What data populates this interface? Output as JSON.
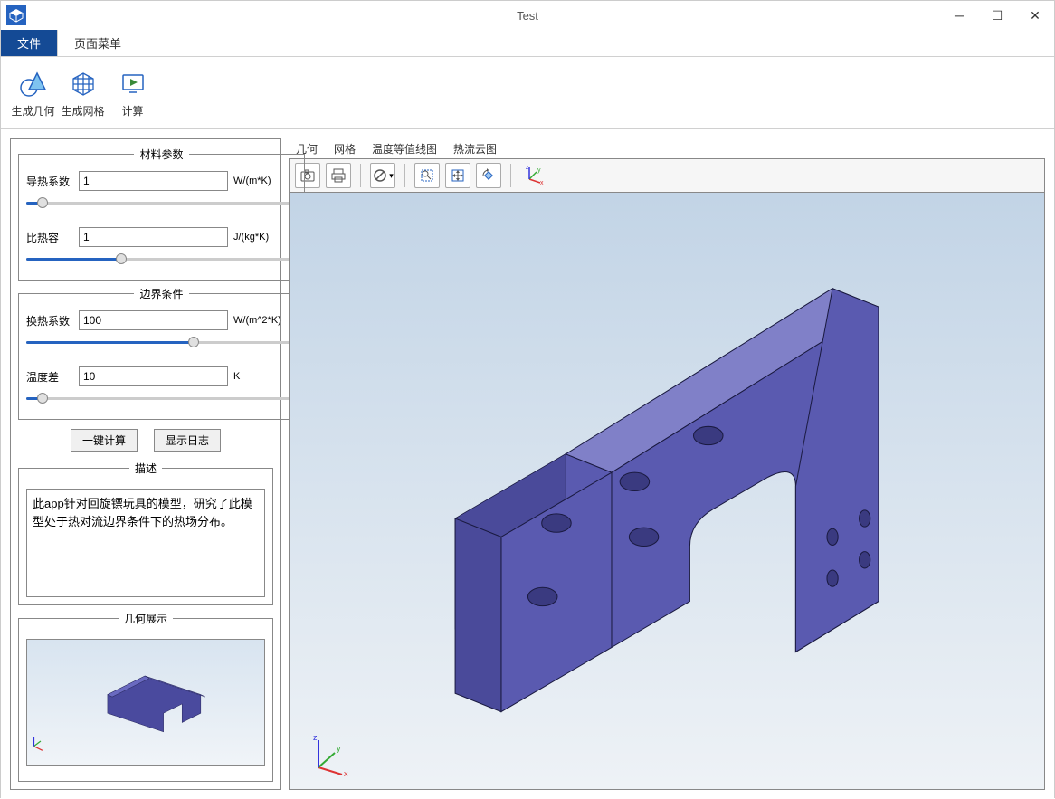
{
  "window": {
    "title": "Test"
  },
  "menu": {
    "file": "文件",
    "page": "页面菜单"
  },
  "ribbon": {
    "gen_geom": "生成几何",
    "gen_mesh": "生成网格",
    "compute": "计算"
  },
  "panels": {
    "material": {
      "title": "材料参数",
      "cond_label": "导热系数",
      "cond_val": "1",
      "cond_unit": "W/(m*K)",
      "heat_label": "比热容",
      "heat_val": "1",
      "heat_unit": "J/(kg*K)"
    },
    "boundary": {
      "title": "边界条件",
      "htc_label": "换热系数",
      "htc_val": "100",
      "htc_unit": "W/(m^2*K)",
      "dt_label": "温度差",
      "dt_val": "10",
      "dt_unit": "K"
    },
    "buttons": {
      "onekey": "一键计算",
      "showlog": "显示日志"
    },
    "desc": {
      "title": "描述",
      "text": "此app针对回旋镖玩具的模型，研究了此模型处于热对流边界条件下的热场分布。"
    },
    "geom": {
      "title": "几何展示"
    }
  },
  "viewtabs": {
    "geom": "几何",
    "mesh": "网格",
    "temp": "温度等值线图",
    "flux": "热流云图"
  }
}
